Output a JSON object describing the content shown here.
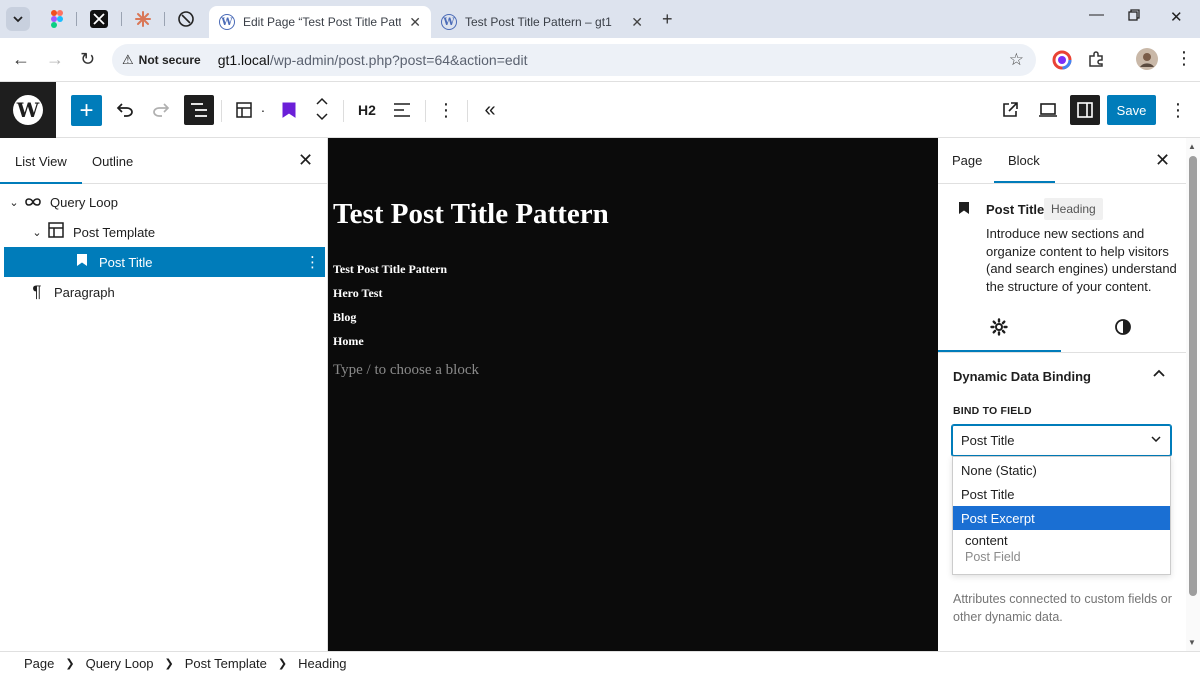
{
  "browser": {
    "tabs": [
      {
        "title": "Edit Page “Test Post Title Pattern”",
        "active": true
      },
      {
        "title": "Test Post Title Pattern – gt1",
        "active": false
      }
    ],
    "security_label": "Not secure",
    "url_host": "gt1.local",
    "url_path": "/wp-admin/post.php?post=64&action=edit"
  },
  "toolbar": {
    "block_level": "H2",
    "save_label": "Save"
  },
  "left_panel": {
    "tabs": [
      "List View",
      "Outline"
    ],
    "tree": [
      {
        "label": "Query Loop",
        "icon": "loop-icon"
      },
      {
        "label": "Post Template",
        "icon": "layout-icon"
      },
      {
        "label": "Post Title",
        "icon": "bookmark-icon",
        "selected": true
      },
      {
        "label": "Paragraph",
        "icon": "pilcrow-icon"
      }
    ]
  },
  "canvas": {
    "heading": "Test Post Title Pattern",
    "links": [
      "Test Post Title Pattern",
      "Hero Test",
      "Blog",
      "Home"
    ],
    "placeholder": "Type / to choose a block",
    "background": "#0b0b0b"
  },
  "right_panel": {
    "tabs": [
      "Page",
      "Block"
    ],
    "block_name": "Post Title",
    "block_badge": "Heading",
    "block_description": "Introduce new sections and organize content to help visitors (and search engines) understand the structure of your content.",
    "panel_title": "Dynamic Data Binding",
    "bind_label": "Bind to field",
    "selected_field": "Post Title",
    "options": [
      "None (Static)",
      "Post Title",
      "Post Excerpt"
    ],
    "highlighted_option": "Post Excerpt",
    "option_group": {
      "value": "content",
      "label": "Post Field"
    },
    "help_text": "Attributes connected to custom fields or other dynamic data."
  },
  "breadcrumb": [
    "Page",
    "Query Loop",
    "Post Template",
    "Heading"
  ],
  "colors": {
    "accent": "#007cba",
    "highlight": "#1a6fd3",
    "dark": "#1e1e1e"
  }
}
